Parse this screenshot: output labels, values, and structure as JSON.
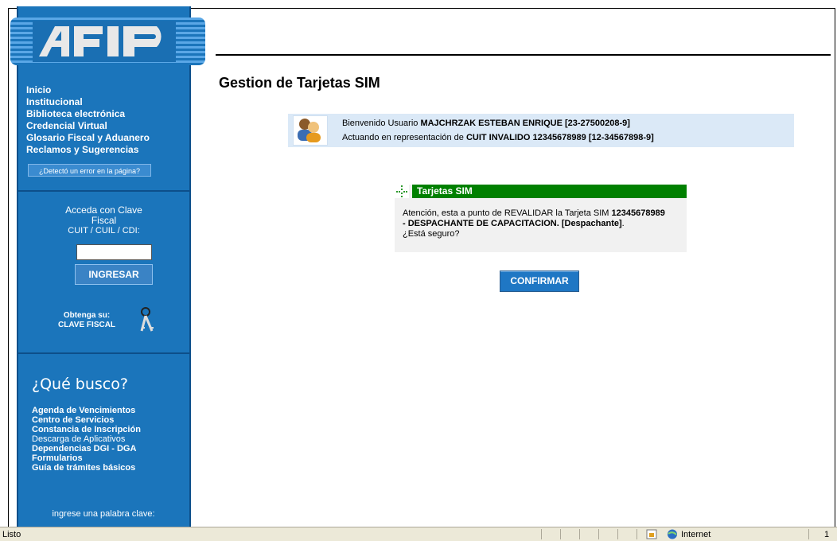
{
  "logo": {
    "text": "AFIP"
  },
  "sidebar": {
    "nav": [
      "Inicio",
      "Institucional",
      "Biblioteca electrónica",
      "Credencial Virtual",
      "Glosario Fiscal y Aduanero",
      "Reclamos y Sugerencias"
    ],
    "error_button": "¿Detectó un error en la página?",
    "login": {
      "line1": "Acceda con Clave",
      "line2": "Fiscal",
      "line3": "CUIT / CUIL / CDI:",
      "input_value": "",
      "button": "INGRESAR"
    },
    "clave": {
      "line1": "Obtenga su:",
      "line2": "CLAVE FISCAL"
    },
    "que_busco": "¿Qué busco?",
    "links": [
      "Agenda de Vencimientos",
      "Centro de Servicios",
      "Constancia de Inscripción",
      "Descarga de Aplicativos",
      "Dependencias DGI - DGA",
      "Formularios",
      "Guía de trámites básicos"
    ],
    "keyword_label": "ingrese una palabra clave:"
  },
  "main": {
    "title": "Gestion de Tarjetas SIM",
    "welcome": {
      "prefix1": "Bienvenido Usuario ",
      "user": "MAJCHRZAK ESTEBAN ENRIQUE [23-27500208-9]",
      "prefix2": "Actuando en representación de ",
      "represent": "CUIT INVALIDO 12345678989 [12-34567898-9]"
    },
    "panel": {
      "title": "Tarjetas SIM",
      "text1": "Atención, esta a punto de REVALIDAR la Tarjeta SIM ",
      "card": "12345678989",
      "text2": "- DESPACHANTE DE CAPACITACION. [Despachante]",
      "text3": ".",
      "question": "¿Está seguro?"
    },
    "confirm_button": "CONFIRMAR"
  },
  "statusbar": {
    "status": "Listo",
    "zone": "Internet",
    "zoom": "1"
  }
}
